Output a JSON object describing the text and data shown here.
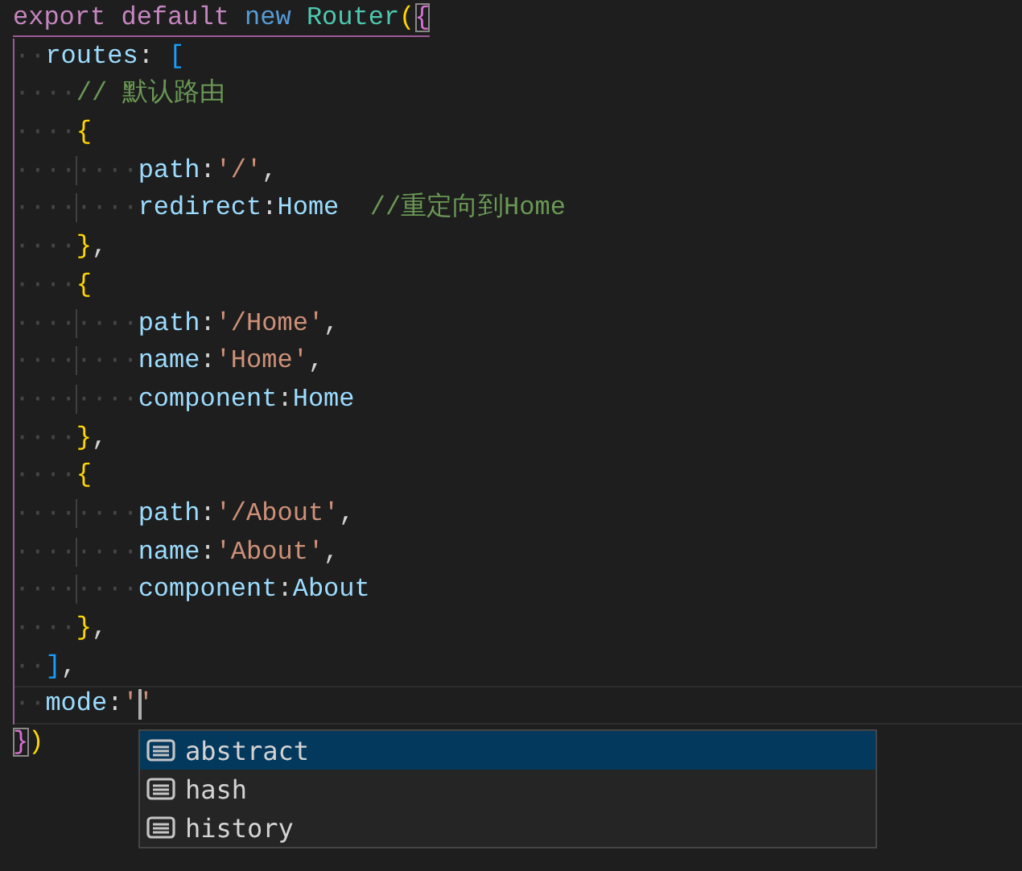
{
  "editor": {
    "lines": [
      {
        "current": false,
        "tokens": [
          {
            "kind": "keyword",
            "text": "export default "
          },
          {
            "kind": "storage",
            "text": "new "
          },
          {
            "kind": "class",
            "text": "Router"
          },
          {
            "kind": "paren",
            "text": "("
          },
          {
            "kind": "brace2",
            "text": "{",
            "matched": true
          }
        ]
      },
      {
        "lead": "··",
        "current": false,
        "tokens": [
          {
            "kind": "property",
            "text": "routes"
          },
          {
            "kind": "punct",
            "text": ": "
          },
          {
            "kind": "bracket",
            "text": "["
          }
        ]
      },
      {
        "lead": "····",
        "current": false,
        "tokens": [
          {
            "kind": "comment",
            "text": "// 默认路由"
          }
        ]
      },
      {
        "lead": "····",
        "current": false,
        "tokens": [
          {
            "kind": "paren",
            "text": "{"
          }
        ]
      },
      {
        "lead": "········",
        "current": false,
        "tokens": [
          {
            "kind": "property",
            "text": "path"
          },
          {
            "kind": "punct",
            "text": ":"
          },
          {
            "kind": "string",
            "text": "'/'"
          },
          {
            "kind": "punct",
            "text": ","
          }
        ]
      },
      {
        "lead": "········",
        "current": false,
        "tokens": [
          {
            "kind": "property",
            "text": "redirect"
          },
          {
            "kind": "punct",
            "text": ":"
          },
          {
            "kind": "variable",
            "text": "Home  "
          },
          {
            "kind": "comment",
            "text": "//重定向到Home"
          }
        ]
      },
      {
        "lead": "····",
        "current": false,
        "tokens": [
          {
            "kind": "paren",
            "text": "}"
          },
          {
            "kind": "punct",
            "text": ","
          }
        ]
      },
      {
        "lead": "····",
        "current": false,
        "tokens": [
          {
            "kind": "paren",
            "text": "{"
          }
        ]
      },
      {
        "lead": "········",
        "current": false,
        "tokens": [
          {
            "kind": "property",
            "text": "path"
          },
          {
            "kind": "punct",
            "text": ":"
          },
          {
            "kind": "string",
            "text": "'/Home'"
          },
          {
            "kind": "punct",
            "text": ","
          }
        ]
      },
      {
        "lead": "········",
        "current": false,
        "tokens": [
          {
            "kind": "property",
            "text": "name"
          },
          {
            "kind": "punct",
            "text": ":"
          },
          {
            "kind": "string",
            "text": "'Home'"
          },
          {
            "kind": "punct",
            "text": ","
          }
        ]
      },
      {
        "lead": "········",
        "current": false,
        "tokens": [
          {
            "kind": "property",
            "text": "component"
          },
          {
            "kind": "punct",
            "text": ":"
          },
          {
            "kind": "variable",
            "text": "Home"
          }
        ]
      },
      {
        "lead": "····",
        "current": false,
        "tokens": [
          {
            "kind": "paren",
            "text": "}"
          },
          {
            "kind": "punct",
            "text": ","
          }
        ]
      },
      {
        "lead": "····",
        "current": false,
        "tokens": [
          {
            "kind": "paren",
            "text": "{"
          }
        ]
      },
      {
        "lead": "········",
        "current": false,
        "tokens": [
          {
            "kind": "property",
            "text": "path"
          },
          {
            "kind": "punct",
            "text": ":"
          },
          {
            "kind": "string",
            "text": "'/About'"
          },
          {
            "kind": "punct",
            "text": ","
          }
        ]
      },
      {
        "lead": "········",
        "current": false,
        "tokens": [
          {
            "kind": "property",
            "text": "name"
          },
          {
            "kind": "punct",
            "text": ":"
          },
          {
            "kind": "string",
            "text": "'About'"
          },
          {
            "kind": "punct",
            "text": ","
          }
        ]
      },
      {
        "lead": "········",
        "current": false,
        "tokens": [
          {
            "kind": "property",
            "text": "component"
          },
          {
            "kind": "punct",
            "text": ":"
          },
          {
            "kind": "variable",
            "text": "About"
          }
        ]
      },
      {
        "lead": "····",
        "current": false,
        "tokens": [
          {
            "kind": "paren",
            "text": "}"
          },
          {
            "kind": "punct",
            "text": ","
          }
        ]
      },
      {
        "lead": "··",
        "current": false,
        "tokens": [
          {
            "kind": "bracket",
            "text": "]"
          },
          {
            "kind": "punct",
            "text": ","
          }
        ]
      },
      {
        "lead": "··",
        "current": true,
        "tokens": [
          {
            "kind": "property",
            "text": "mode"
          },
          {
            "kind": "punct",
            "text": ":"
          },
          {
            "kind": "string",
            "text": "'"
          },
          {
            "kind": "cursor"
          },
          {
            "kind": "string",
            "text": "'"
          }
        ]
      },
      {
        "current": false,
        "tokens": [
          {
            "kind": "brace2",
            "text": "}",
            "matched": true
          },
          {
            "kind": "paren",
            "text": ")"
          }
        ]
      }
    ]
  },
  "suggestions": [
    {
      "label": "abstract",
      "selected": true
    },
    {
      "label": "hash",
      "selected": false
    },
    {
      "label": "history",
      "selected": false
    }
  ]
}
